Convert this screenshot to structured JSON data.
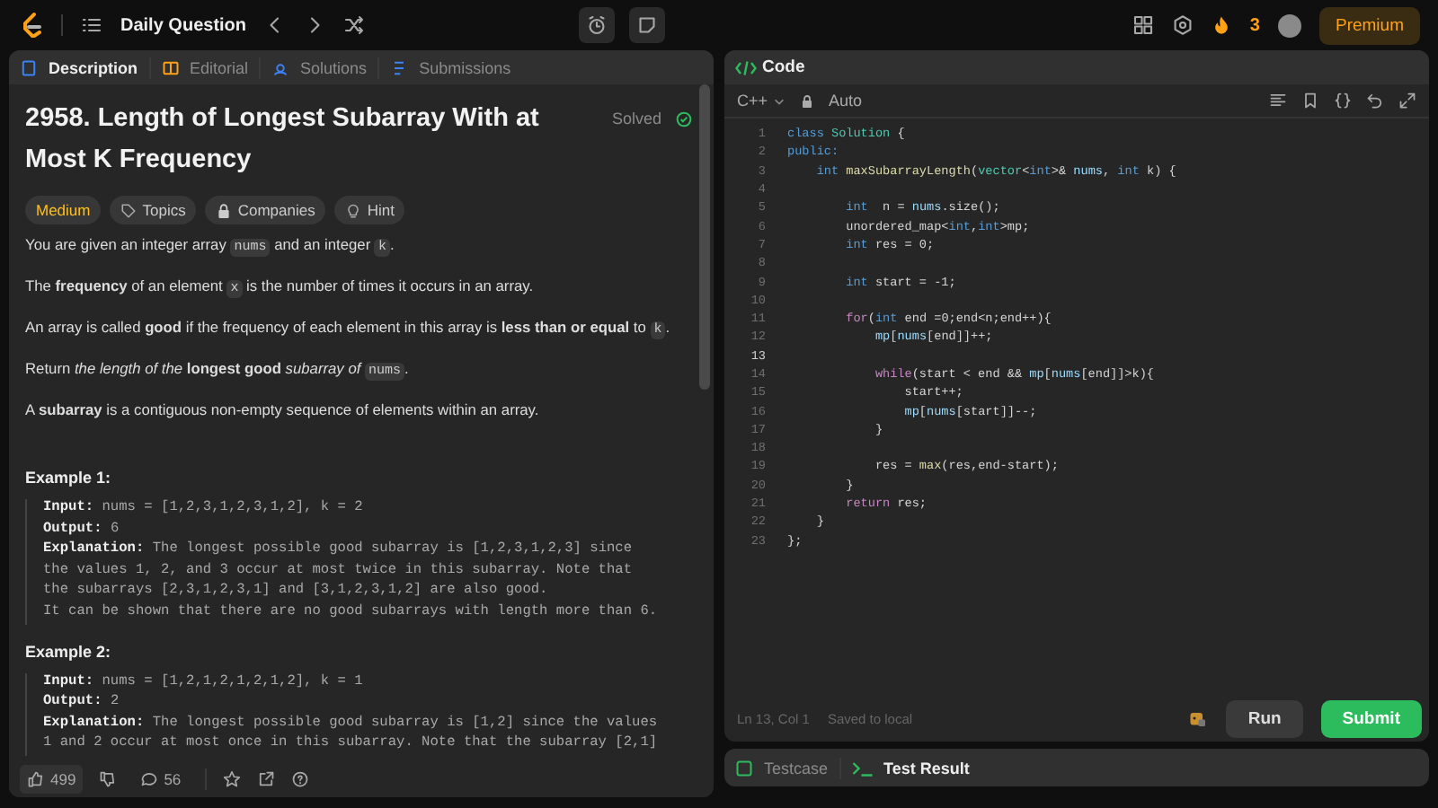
{
  "top_bar": {
    "title": "Daily Question",
    "streak": "3",
    "premium": "Premium"
  },
  "left_panel": {
    "tabs": [
      {
        "label": "Description",
        "selected": true
      },
      {
        "label": "Editorial",
        "selected": false
      },
      {
        "label": "Solutions",
        "selected": false
      },
      {
        "label": "Submissions",
        "selected": false
      }
    ],
    "problem_title": "2958. Length of Longest Subarray With at Most K Frequency",
    "status": "Solved",
    "tags": [
      {
        "label": "Medium",
        "kind": "difficulty"
      },
      {
        "label": "Topics",
        "kind": "tag"
      },
      {
        "label": "Companies",
        "kind": "lock"
      },
      {
        "label": "Hint",
        "kind": "bulb"
      }
    ],
    "paragraphs": [
      [
        {
          "kind": "text",
          "text": "You are given an integer array "
        },
        {
          "kind": "code",
          "text": "nums"
        },
        {
          "kind": "text",
          "text": " and an integer "
        },
        {
          "kind": "code",
          "text": "k"
        },
        {
          "kind": "text",
          "text": "."
        }
      ],
      [
        {
          "kind": "text",
          "text": "The **frequency** of an element "
        },
        {
          "kind": "code",
          "text": "x"
        },
        {
          "kind": "text",
          "text": " is the number of times it occurs in an array."
        }
      ],
      [
        {
          "kind": "text",
          "text": "An array is called **good** if the frequency of each element in this array is **less than or equal** to "
        },
        {
          "kind": "code",
          "text": "k"
        },
        {
          "kind": "text",
          "text": "."
        }
      ],
      [
        {
          "kind": "text",
          "text": "Return *the length of the* **longest good** *subarray of* "
        },
        {
          "kind": "code",
          "text": "nums"
        },
        {
          "kind": "text",
          "text": "."
        }
      ],
      [
        {
          "kind": "text",
          "text": "A **subarray** is a contiguous non-empty sequence of elements within an array."
        }
      ]
    ],
    "examples": [
      {
        "title": "Example 1:",
        "lines": [
          "**Input:** nums = [1,2,3,1,2,3,1,2], k = 2",
          "**Output:** 6",
          "**Explanation:** The longest possible good subarray is [1,2,3,1,2,3] since",
          "the values 1, 2, and 3 occur at most twice in this subarray. Note that",
          "the subarrays [2,3,1,2,3,1] and [3,1,2,3,1,2] are also good.",
          "It can be shown that there are no good subarrays with length more than 6."
        ]
      },
      {
        "title": "Example 2:",
        "lines": [
          "**Input:** nums = [1,2,1,2,1,2,1,2], k = 1",
          "**Output:** 2",
          "**Explanation:** The longest possible good subarray is [1,2] since the values",
          "1 and 2 occur at most once in this subarray. Note that the subarray [2,1]"
        ]
      }
    ],
    "footer": {
      "likes": "499",
      "comments": "56"
    }
  },
  "code_panel": {
    "title": "Code",
    "language": "C++",
    "mode": "Auto",
    "lines": [
      {
        "number": "1",
        "current": false,
        "tokens": [
          {
            "kind": "keyword",
            "text": "class "
          },
          {
            "kind": "type",
            "text": "Solution"
          },
          {
            "kind": "plain",
            "text": " {"
          }
        ]
      },
      {
        "number": "2",
        "current": false,
        "tokens": [
          {
            "kind": "keyword",
            "text": "public:"
          }
        ]
      },
      {
        "number": "3",
        "current": false,
        "tokens": [
          {
            "kind": "keyword",
            "text": "    int "
          },
          {
            "kind": "func",
            "text": "maxSubarrayLength"
          },
          {
            "kind": "plain",
            "text": "("
          },
          {
            "kind": "type",
            "text": "vector"
          },
          {
            "kind": "plain",
            "text": "<"
          },
          {
            "kind": "keyword",
            "text": "int"
          },
          {
            "kind": "plain",
            "text": ">& "
          },
          {
            "kind": "var",
            "text": "nums"
          },
          {
            "kind": "plain",
            "text": ", "
          },
          {
            "kind": "keyword",
            "text": "int"
          },
          {
            "kind": "plain",
            "text": " k) {"
          }
        ]
      },
      {
        "number": "4",
        "current": false
      },
      {
        "number": "5",
        "current": false,
        "tokens": [
          {
            "kind": "keyword",
            "text": "        int"
          },
          {
            "kind": "plain",
            "text": "  n = "
          },
          {
            "kind": "var",
            "text": "nums"
          },
          {
            "kind": "plain",
            "text": ".size();"
          }
        ]
      },
      {
        "number": "6",
        "current": false,
        "tokens": [
          {
            "kind": "plain",
            "text": "        unordered_map<"
          },
          {
            "kind": "keyword",
            "text": "int"
          },
          {
            "kind": "plain",
            "text": ","
          },
          {
            "kind": "keyword",
            "text": "int"
          },
          {
            "kind": "plain",
            "text": ">mp;"
          }
        ]
      },
      {
        "number": "7",
        "current": false,
        "tokens": [
          {
            "kind": "keyword",
            "text": "        int"
          },
          {
            "kind": "plain",
            "text": " res = 0;"
          }
        ]
      },
      {
        "number": "8",
        "current": false
      },
      {
        "number": "9",
        "current": false,
        "tokens": [
          {
            "kind": "keyword",
            "text": "        int"
          },
          {
            "kind": "plain",
            "text": " start = -1;"
          }
        ]
      },
      {
        "number": "10",
        "current": false
      },
      {
        "number": "11",
        "current": false,
        "tokens": [
          {
            "kind": "control",
            "text": "        for"
          },
          {
            "kind": "plain",
            "text": "("
          },
          {
            "kind": "keyword",
            "text": "int"
          },
          {
            "kind": "plain",
            "text": " end =0;end<n;end++){"
          }
        ]
      },
      {
        "number": "12",
        "current": false,
        "tokens": [
          {
            "kind": "var",
            "text": "            mp"
          },
          {
            "kind": "plain",
            "text": "["
          },
          {
            "kind": "var",
            "text": "nums"
          },
          {
            "kind": "plain",
            "text": "[end]]++;"
          }
        ]
      },
      {
        "number": "13",
        "current": true
      },
      {
        "number": "14",
        "current": false,
        "tokens": [
          {
            "kind": "control",
            "text": "            while"
          },
          {
            "kind": "plain",
            "text": "(start < end && "
          },
          {
            "kind": "var",
            "text": "mp"
          },
          {
            "kind": "plain",
            "text": "["
          },
          {
            "kind": "var",
            "text": "nums"
          },
          {
            "kind": "plain",
            "text": "[end]]>k){"
          }
        ]
      },
      {
        "number": "15",
        "current": false,
        "tokens": [
          {
            "kind": "plain",
            "text": "                start++;"
          }
        ]
      },
      {
        "number": "16",
        "current": false,
        "tokens": [
          {
            "kind": "var",
            "text": "                mp"
          },
          {
            "kind": "plain",
            "text": "["
          },
          {
            "kind": "var",
            "text": "nums"
          },
          {
            "kind": "plain",
            "text": "[start]]--;"
          }
        ]
      },
      {
        "number": "17",
        "current": false,
        "tokens": [
          {
            "kind": "plain",
            "text": "            }"
          }
        ]
      },
      {
        "number": "18",
        "current": false
      },
      {
        "number": "19",
        "current": false,
        "tokens": [
          {
            "kind": "plain",
            "text": "            res = "
          },
          {
            "kind": "func",
            "text": "max"
          },
          {
            "kind": "plain",
            "text": "(res,end-start);"
          }
        ]
      },
      {
        "number": "20",
        "current": false,
        "tokens": [
          {
            "kind": "plain",
            "text": "        }"
          }
        ]
      },
      {
        "number": "21",
        "current": false,
        "tokens": [
          {
            "kind": "control",
            "text": "        return"
          },
          {
            "kind": "plain",
            "text": " res;"
          }
        ]
      },
      {
        "number": "22",
        "current": false,
        "tokens": [
          {
            "kind": "plain",
            "text": "    }"
          }
        ]
      },
      {
        "number": "23",
        "current": false,
        "tokens": [
          {
            "kind": "plain",
            "text": "};"
          }
        ]
      }
    ],
    "cursor": "Ln 13, Col 1",
    "save_status": "Saved to local",
    "run": "Run",
    "submit": "Submit"
  },
  "bottom_panel": {
    "tabs": [
      {
        "label": "Testcase",
        "selected": false
      },
      {
        "label": "Test Result",
        "selected": true
      }
    ]
  }
}
